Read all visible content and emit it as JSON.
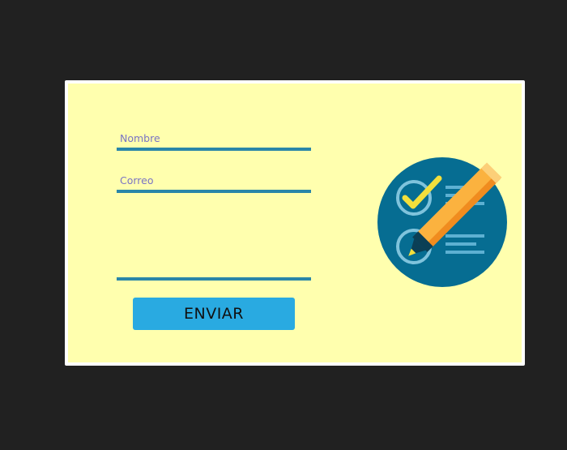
{
  "form": {
    "name_placeholder": "Nombre",
    "email_placeholder": "Correo",
    "message_placeholder": "",
    "submit_label": "ENVIAR"
  },
  "illustration": {
    "icon": "checklist-pencil-icon"
  },
  "colors": {
    "page_background": "#212121",
    "card_background": "#ffffae",
    "field_underline": "#2a86a8",
    "button_background": "#29aae1",
    "icon_circle": "#066d92"
  }
}
